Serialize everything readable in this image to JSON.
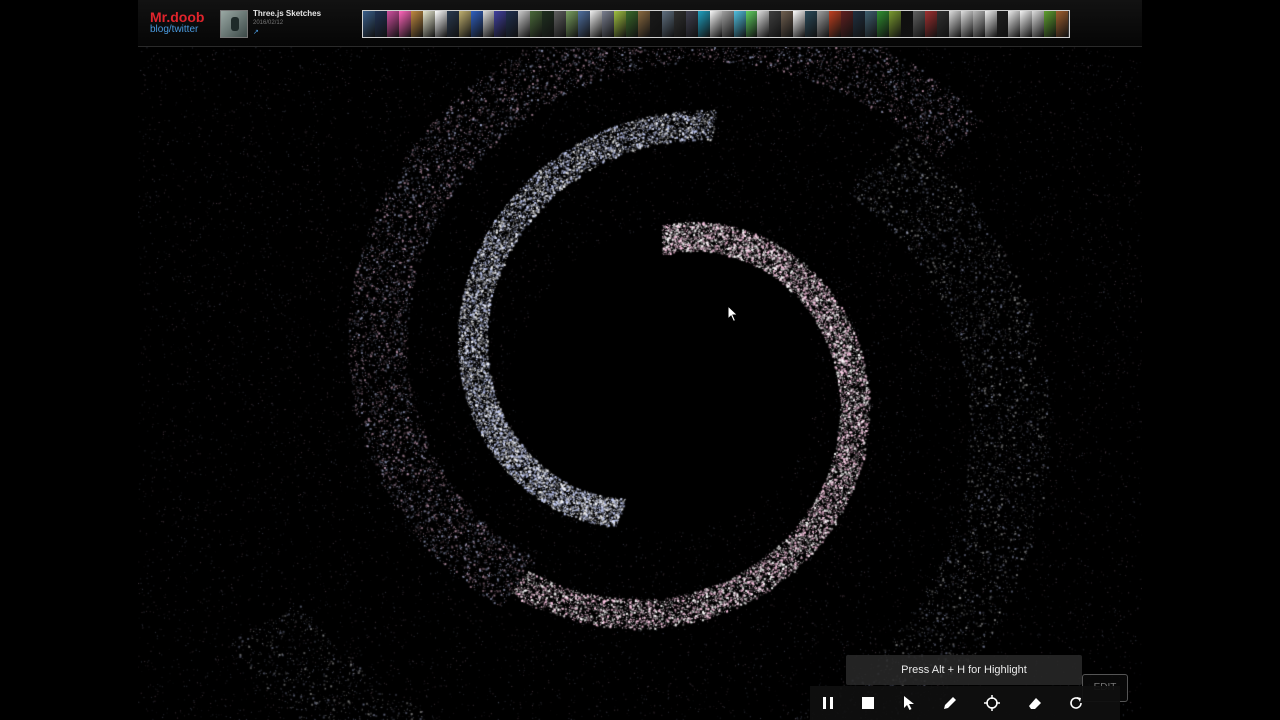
{
  "header": {
    "brand": "Mr.doob",
    "brand_links": "blog/twitter",
    "project_title": "Three.js Sketches",
    "project_date": "2016/02/12",
    "external_link_icon": "external-link-icon"
  },
  "thumbnail_strip": {
    "tile_colors": [
      "#3a5f8a",
      "#223355",
      "#d04fa0",
      "#ff66bb",
      "#c08a40",
      "#e8e8d0",
      "#ffffff",
      "#2a3a50",
      "#c0b070",
      "#3060c0",
      "#ddd",
      "#4040a0",
      "#203050",
      "#ccc",
      "#4a6a3a",
      "#203020",
      "#606060",
      "#7aa060",
      "#5070a0",
      "#f0f0f0",
      "#7b8090",
      "#a0c040",
      "#3a6a2a",
      "#8a6a40",
      "#1a1a1a",
      "#607080",
      "#303030",
      "#404050",
      "#20a0c0",
      "#f8f8f8",
      "#a0a0a0",
      "#50c0e0",
      "#60d060",
      "#e0e0e0",
      "#404040",
      "#706050",
      "#ffffff",
      "#2a4a5a",
      "#a0a0a0",
      "#c04020",
      "#602020",
      "#203040",
      "#406070",
      "#309030",
      "#7a9a30",
      "#101010",
      "#606060",
      "#a03030",
      "#303030",
      "#dedede",
      "#e0e0e0",
      "#bbb",
      "#f0f0f0",
      "#202020",
      "#ececec",
      "#f4f4f4",
      "#ddd",
      "#60a030",
      "#a06030"
    ]
  },
  "recorder": {
    "hint": "Press Alt + H for Highlight",
    "edit_label": "EDIT",
    "buttons": [
      "pause-icon",
      "stop-icon",
      "pointer-icon",
      "pen-icon",
      "crosshair-icon",
      "eraser-icon",
      "refresh-icon"
    ]
  },
  "colors": {
    "brand_red": "#e0242c",
    "link_blue": "#4a9be0",
    "particle_pink": "#ffc8e6",
    "particle_blue": "#c8d2ff"
  }
}
